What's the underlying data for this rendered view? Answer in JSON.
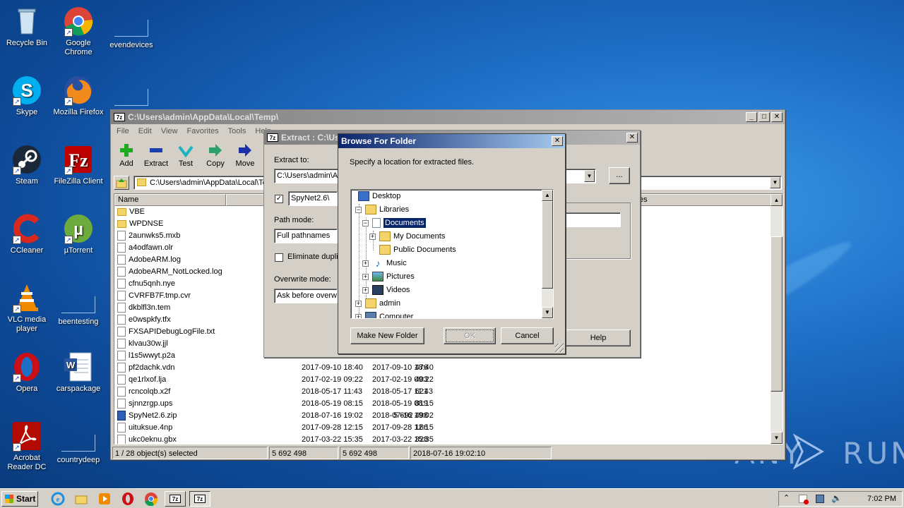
{
  "desktop": {
    "icons": [
      {
        "label": "Recycle Bin"
      },
      {
        "label": "Google Chrome"
      },
      {
        "label": "evendevices"
      },
      {
        "label": "Skype"
      },
      {
        "label": "Mozilla Firefox"
      },
      {
        "label": "Steam"
      },
      {
        "label": "FileZilla Client"
      },
      {
        "label": "CCleaner"
      },
      {
        "label": "µTorrent"
      },
      {
        "label": "VLC media player"
      },
      {
        "label": "beentesting"
      },
      {
        "label": "Opera"
      },
      {
        "label": "carspackage"
      },
      {
        "label": "Acrobat Reader DC"
      },
      {
        "label": "countrydeep"
      }
    ],
    "watermark": "ANY RUN"
  },
  "fm": {
    "title": "C:\\Users\\admin\\AppData\\Local\\Temp\\",
    "menu": [
      "File",
      "Edit",
      "View",
      "Favorites",
      "Tools",
      "Help"
    ],
    "toolbar": {
      "add": "Add",
      "extract": "Extract",
      "test": "Test",
      "copy": "Copy",
      "move": "Move"
    },
    "address": "C:\\Users\\admin\\AppData\\Local\\Temp\\",
    "col_name": "Name",
    "col_tail": "es",
    "files": [
      {
        "name": "VBE",
        "size": "",
        "modified": "",
        "created": "",
        "kind": "folder"
      },
      {
        "name": "WPDNSE",
        "size": "",
        "modified": "",
        "created": "",
        "kind": "folder"
      },
      {
        "name": "2aunwks5.mxb",
        "size": "",
        "modified": "",
        "created": "",
        "kind": "file"
      },
      {
        "name": "a4odfawn.olr",
        "size": "",
        "modified": "",
        "created": "",
        "kind": "file"
      },
      {
        "name": "AdobeARM.log",
        "size": "",
        "modified": "",
        "created": "",
        "kind": "file"
      },
      {
        "name": "AdobeARM_NotLocked.log",
        "size": "",
        "modified": "",
        "created": "",
        "kind": "file"
      },
      {
        "name": "cfnu5qnh.nye",
        "size": "",
        "modified": "",
        "created": "",
        "kind": "file"
      },
      {
        "name": "CVRFB7F.tmp.cvr",
        "size": "",
        "modified": "",
        "created": "",
        "kind": "file"
      },
      {
        "name": "dkblfl3n.tem",
        "size": "",
        "modified": "",
        "created": "",
        "kind": "file"
      },
      {
        "name": "e0wspkfy.tfx",
        "size": "",
        "modified": "",
        "created": "",
        "kind": "file"
      },
      {
        "name": "FXSAPIDebugLogFile.txt",
        "size": "",
        "modified": "",
        "created": "",
        "kind": "file"
      },
      {
        "name": "klvau30w.jjl",
        "size": "",
        "modified": "",
        "created": "",
        "kind": "file"
      },
      {
        "name": "l1s5wwyt.p2a",
        "size": "",
        "modified": "",
        "created": "",
        "kind": "file"
      },
      {
        "name": "pf2dachk.vdn",
        "size": "476",
        "modified": "2017-09-10 18:40",
        "created": "2017-09-10 18:40",
        "kind": "file"
      },
      {
        "name": "qe1rlxof.lja",
        "size": "403",
        "modified": "2017-02-19 09:22",
        "created": "2017-02-19 09:22",
        "kind": "file"
      },
      {
        "name": "rcncolqb.x2f",
        "size": "621",
        "modified": "2018-05-17 11:43",
        "created": "2018-05-17 11:43",
        "kind": "file"
      },
      {
        "name": "sjnnzrgp.ups",
        "size": "819",
        "modified": "2018-05-19 08:15",
        "created": "2018-05-19 08:15",
        "kind": "file"
      },
      {
        "name": "SpyNet2.6.zip",
        "size": "5 692 498",
        "modified": "2018-07-16 19:02",
        "created": "2018-07-16 19:02",
        "kind": "zip"
      },
      {
        "name": "uituksue.4np",
        "size": "166",
        "modified": "2017-09-28 12:15",
        "created": "2017-09-28 12:15",
        "kind": "file"
      },
      {
        "name": "ukc0eknu.gbx",
        "size": "328",
        "modified": "2017-03-22 15:35",
        "created": "2017-03-22 15:35",
        "kind": "file"
      }
    ],
    "status": {
      "selected": "1 / 28 object(s) selected",
      "size1": "5 692 498",
      "size2": "5 692 498",
      "date": "2018-07-16 19:02:10"
    }
  },
  "extract": {
    "title": "Extract : C:\\Us",
    "extract_to_label": "Extract to:",
    "extract_to_value": "C:\\Users\\admin\\A",
    "browse_label": "...",
    "subfolder_value": "SpyNet2.6\\",
    "path_mode_label": "Path mode:",
    "path_mode_value": "Full pathnames",
    "eliminate_label": "Eliminate duplic",
    "overwrite_label": "Overwrite mode:",
    "overwrite_value": "Ask before overwr",
    "help_label": "Help"
  },
  "browse": {
    "title": "Browse For Folder",
    "instruction": "Specify a location for extracted files.",
    "tree": [
      {
        "label": "Desktop",
        "expander": ""
      },
      {
        "label": "Libraries",
        "expander": "−"
      },
      {
        "label": "Documents",
        "expander": "−"
      },
      {
        "label": "My Documents",
        "expander": "+"
      },
      {
        "label": "Public Documents",
        "expander": ""
      },
      {
        "label": "Music",
        "expander": "+"
      },
      {
        "label": "Pictures",
        "expander": "+"
      },
      {
        "label": "Videos",
        "expander": "+"
      },
      {
        "label": "admin",
        "expander": "+"
      },
      {
        "label": "Computer",
        "expander": "+"
      }
    ],
    "make_folder": "Make New Folder",
    "ok": "OK",
    "cancel": "Cancel"
  },
  "taskbar": {
    "start": "Start",
    "clock": "7:02 PM"
  }
}
